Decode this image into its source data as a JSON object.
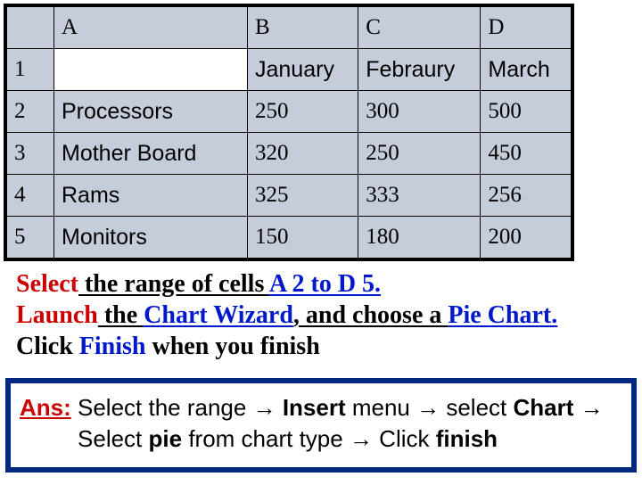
{
  "chart_data": {
    "type": "table",
    "columns": [
      "",
      "January",
      "Febraury",
      "March"
    ],
    "rows": [
      {
        "label": "Processors",
        "values": [
          250,
          300,
          500
        ]
      },
      {
        "label": "Mother Board",
        "values": [
          320,
          250,
          450
        ]
      },
      {
        "label": "Rams",
        "values": [
          325,
          333,
          256
        ]
      },
      {
        "label": "Monitors",
        "values": [
          150,
          180,
          200
        ]
      }
    ]
  },
  "grid": {
    "col_headers": [
      "A",
      "B",
      "C",
      "D"
    ],
    "row_headers": [
      "1",
      "2",
      "3",
      "4",
      "5"
    ],
    "r1": {
      "a": "",
      "b": "January",
      "c": "Febraury",
      "d": "March"
    },
    "r2": {
      "a": "Processors",
      "b": "250",
      "c": "300",
      "d": "500"
    },
    "r3": {
      "a": "Mother Board",
      "b": "320",
      "c": "250",
      "d": "450"
    },
    "r4": {
      "a": "Rams",
      "b": "325",
      "c": "333",
      "d": "256"
    },
    "r5": {
      "a": "Monitors",
      "b": "150",
      "c": "180",
      "d": "200"
    }
  },
  "instructions": {
    "line1_a": "Select",
    "line1_b": " the range of cells ",
    "line1_c": "A 2 to D 5.",
    "line2_a": "Launch",
    "line2_b": " the ",
    "line2_c": "Chart Wizard",
    "line2_d": ", and choose a ",
    "line2_e": "Pie Chart.",
    "line3_a": "Click ",
    "line3_b": "Finish",
    "line3_c": " when you finish"
  },
  "answer": {
    "label": "Ans:",
    "part1": " Select the range ",
    "arrow": "→",
    "part2": " Insert",
    "part3": " menu ",
    "part4": " select ",
    "part5": "Chart ",
    "part6": "Select ",
    "part7": "pie",
    "part8": " from chart type ",
    "part9": " Click ",
    "part10": "finish"
  }
}
